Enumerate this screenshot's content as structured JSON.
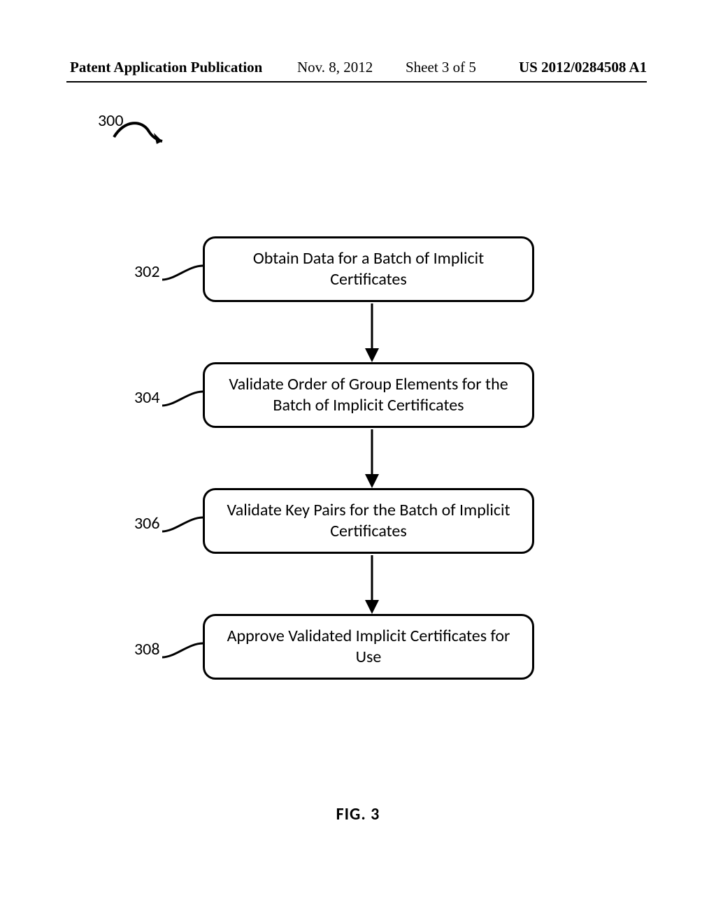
{
  "header": {
    "publication": "Patent Application Publication",
    "date": "Nov. 8, 2012",
    "sheet": "Sheet 3 of 5",
    "appnum": "US 2012/0284508 A1"
  },
  "figure": {
    "ref": "300",
    "caption": "FIG. 3"
  },
  "chart_data": {
    "type": "flowchart",
    "title": "300",
    "caption": "FIG. 3",
    "direction": "top-to-bottom",
    "nodes": [
      {
        "id": "302",
        "label": "302",
        "text": "Obtain Data for a Batch of Implicit Certificates"
      },
      {
        "id": "304",
        "label": "304",
        "text": "Validate Order of Group Elements for the Batch of Implicit Certificates"
      },
      {
        "id": "306",
        "label": "306",
        "text": "Validate Key Pairs for the Batch of Implicit Certificates"
      },
      {
        "id": "308",
        "label": "308",
        "text": "Approve Validated Implicit Certificates for Use"
      }
    ],
    "edges": [
      {
        "from": "302",
        "to": "304"
      },
      {
        "from": "304",
        "to": "306"
      },
      {
        "from": "306",
        "to": "308"
      }
    ]
  }
}
